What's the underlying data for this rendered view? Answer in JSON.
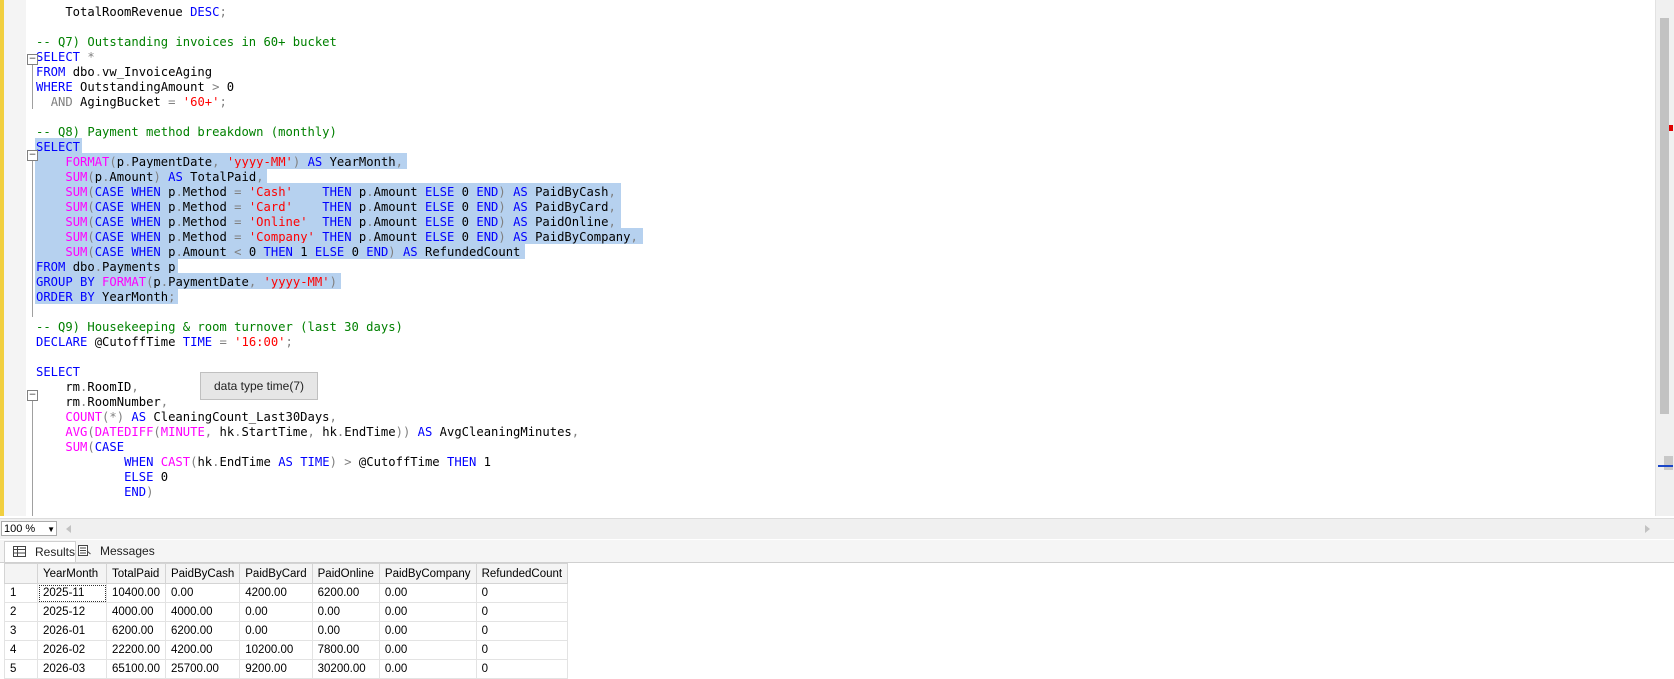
{
  "editor": {
    "lines": [
      {
        "segs": [
          [
            "",
            "    TotalRoomRevenue "
          ],
          [
            "kw",
            "DESC"
          ],
          [
            "op",
            ";"
          ]
        ]
      },
      {
        "segs": []
      },
      {
        "segs": [
          [
            "cm",
            "-- Q7) Outstanding invoices in 60+ bucket"
          ]
        ]
      },
      {
        "segs": [
          [
            "kw",
            "SELECT "
          ],
          [
            "op",
            "*"
          ]
        ]
      },
      {
        "segs": [
          [
            "kw",
            "FROM "
          ],
          [
            "",
            "dbo"
          ],
          [
            "op",
            "."
          ],
          [
            "",
            "vw_InvoiceAging"
          ]
        ]
      },
      {
        "segs": [
          [
            "kw",
            "WHERE "
          ],
          [
            "",
            "OutstandingAmount "
          ],
          [
            "op",
            ">"
          ],
          [
            "",
            " 0"
          ]
        ]
      },
      {
        "segs": [
          [
            "",
            "  "
          ],
          [
            "op",
            "AND "
          ],
          [
            "",
            "AgingBucket "
          ],
          [
            "op",
            "="
          ],
          [
            "",
            " "
          ],
          [
            "str",
            "'60+'"
          ],
          [
            "op",
            ";"
          ]
        ]
      },
      {
        "segs": []
      },
      {
        "segs": [
          [
            "cm",
            "-- Q8) Payment method breakdown (monthly)"
          ]
        ]
      },
      {
        "segs": [
          [
            "kw",
            "SELECT"
          ]
        ]
      },
      {
        "segs": [
          [
            "",
            "    "
          ],
          [
            "fn",
            "FORMAT"
          ],
          [
            "op",
            "("
          ],
          [
            "",
            "p"
          ],
          [
            "op",
            "."
          ],
          [
            "",
            "PaymentDate"
          ],
          [
            "op",
            ","
          ],
          [
            "",
            " "
          ],
          [
            "str",
            "'yyyy-MM'"
          ],
          [
            "op",
            ")"
          ],
          [
            "",
            " "
          ],
          [
            "kw",
            "AS "
          ],
          [
            "",
            "YearMonth"
          ],
          [
            "op",
            ","
          ]
        ]
      },
      {
        "segs": [
          [
            "",
            "    "
          ],
          [
            "fn",
            "SUM"
          ],
          [
            "op",
            "("
          ],
          [
            "",
            "p"
          ],
          [
            "op",
            "."
          ],
          [
            "",
            "Amount"
          ],
          [
            "op",
            ")"
          ],
          [
            "",
            " "
          ],
          [
            "kw",
            "AS "
          ],
          [
            "",
            "TotalPaid"
          ],
          [
            "op",
            ","
          ]
        ]
      },
      {
        "segs": [
          [
            "",
            "    "
          ],
          [
            "fn",
            "SUM"
          ],
          [
            "op",
            "("
          ],
          [
            "kw",
            "CASE WHEN "
          ],
          [
            "",
            "p"
          ],
          [
            "op",
            "."
          ],
          [
            "",
            "Method "
          ],
          [
            "op",
            "="
          ],
          [
            "",
            " "
          ],
          [
            "str",
            "'Cash'"
          ],
          [
            "",
            "    "
          ],
          [
            "kw",
            "THEN "
          ],
          [
            "",
            "p"
          ],
          [
            "op",
            "."
          ],
          [
            "",
            "Amount "
          ],
          [
            "kw",
            "ELSE "
          ],
          [
            "",
            "0 "
          ],
          [
            "kw",
            "END"
          ],
          [
            "op",
            ")"
          ],
          [
            "",
            " "
          ],
          [
            "kw",
            "AS "
          ],
          [
            "",
            "PaidByCash"
          ],
          [
            "op",
            ","
          ]
        ]
      },
      {
        "segs": [
          [
            "",
            "    "
          ],
          [
            "fn",
            "SUM"
          ],
          [
            "op",
            "("
          ],
          [
            "kw",
            "CASE WHEN "
          ],
          [
            "",
            "p"
          ],
          [
            "op",
            "."
          ],
          [
            "",
            "Method "
          ],
          [
            "op",
            "="
          ],
          [
            "",
            " "
          ],
          [
            "str",
            "'Card'"
          ],
          [
            "",
            "    "
          ],
          [
            "kw",
            "THEN "
          ],
          [
            "",
            "p"
          ],
          [
            "op",
            "."
          ],
          [
            "",
            "Amount "
          ],
          [
            "kw",
            "ELSE "
          ],
          [
            "",
            "0 "
          ],
          [
            "kw",
            "END"
          ],
          [
            "op",
            ")"
          ],
          [
            "",
            " "
          ],
          [
            "kw",
            "AS "
          ],
          [
            "",
            "PaidByCard"
          ],
          [
            "op",
            ","
          ]
        ]
      },
      {
        "segs": [
          [
            "",
            "    "
          ],
          [
            "fn",
            "SUM"
          ],
          [
            "op",
            "("
          ],
          [
            "kw",
            "CASE WHEN "
          ],
          [
            "",
            "p"
          ],
          [
            "op",
            "."
          ],
          [
            "",
            "Method "
          ],
          [
            "op",
            "="
          ],
          [
            "",
            " "
          ],
          [
            "str",
            "'Online'"
          ],
          [
            "",
            "  "
          ],
          [
            "kw",
            "THEN "
          ],
          [
            "",
            "p"
          ],
          [
            "op",
            "."
          ],
          [
            "",
            "Amount "
          ],
          [
            "kw",
            "ELSE "
          ],
          [
            "",
            "0 "
          ],
          [
            "kw",
            "END"
          ],
          [
            "op",
            ")"
          ],
          [
            "",
            " "
          ],
          [
            "kw",
            "AS "
          ],
          [
            "",
            "PaidOnline"
          ],
          [
            "op",
            ","
          ]
        ]
      },
      {
        "segs": [
          [
            "",
            "    "
          ],
          [
            "fn",
            "SUM"
          ],
          [
            "op",
            "("
          ],
          [
            "kw",
            "CASE WHEN "
          ],
          [
            "",
            "p"
          ],
          [
            "op",
            "."
          ],
          [
            "",
            "Method "
          ],
          [
            "op",
            "="
          ],
          [
            "",
            " "
          ],
          [
            "str",
            "'Company'"
          ],
          [
            "",
            " "
          ],
          [
            "kw",
            "THEN "
          ],
          [
            "",
            "p"
          ],
          [
            "op",
            "."
          ],
          [
            "",
            "Amount "
          ],
          [
            "kw",
            "ELSE "
          ],
          [
            "",
            "0 "
          ],
          [
            "kw",
            "END"
          ],
          [
            "op",
            ")"
          ],
          [
            "",
            " "
          ],
          [
            "kw",
            "AS "
          ],
          [
            "",
            "PaidByCompany"
          ],
          [
            "op",
            ","
          ]
        ]
      },
      {
        "segs": [
          [
            "",
            "    "
          ],
          [
            "fn",
            "SUM"
          ],
          [
            "op",
            "("
          ],
          [
            "kw",
            "CASE WHEN "
          ],
          [
            "",
            "p"
          ],
          [
            "op",
            "."
          ],
          [
            "",
            "Amount "
          ],
          [
            "op",
            "<"
          ],
          [
            "",
            " 0 "
          ],
          [
            "kw",
            "THEN "
          ],
          [
            "",
            "1 "
          ],
          [
            "kw",
            "ELSE "
          ],
          [
            "",
            "0 "
          ],
          [
            "kw",
            "END"
          ],
          [
            "op",
            ")"
          ],
          [
            "",
            " "
          ],
          [
            "kw",
            "AS "
          ],
          [
            "",
            "RefundedCount"
          ]
        ]
      },
      {
        "segs": [
          [
            "kw",
            "FROM "
          ],
          [
            "",
            "dbo"
          ],
          [
            "op",
            "."
          ],
          [
            "",
            "Payments p"
          ]
        ]
      },
      {
        "segs": [
          [
            "kw",
            "GROUP BY "
          ],
          [
            "fn",
            "FORMAT"
          ],
          [
            "op",
            "("
          ],
          [
            "",
            "p"
          ],
          [
            "op",
            "."
          ],
          [
            "",
            "PaymentDate"
          ],
          [
            "op",
            ","
          ],
          [
            "",
            " "
          ],
          [
            "str",
            "'yyyy-MM'"
          ],
          [
            "op",
            ")"
          ]
        ]
      },
      {
        "segs": [
          [
            "kw",
            "ORDER BY "
          ],
          [
            "",
            "YearMonth"
          ],
          [
            "op",
            ";"
          ]
        ]
      },
      {
        "segs": []
      },
      {
        "segs": [
          [
            "cm",
            "-- Q9) Housekeeping & room turnover (last 30 days)"
          ]
        ]
      },
      {
        "segs": [
          [
            "kw",
            "DECLARE "
          ],
          [
            "",
            "@CutoffTime "
          ],
          [
            "kw",
            "TIME "
          ],
          [
            "op",
            "="
          ],
          [
            "",
            " "
          ],
          [
            "str",
            "'16:00'"
          ],
          [
            "op",
            ";"
          ]
        ]
      },
      {
        "segs": []
      },
      {
        "segs": [
          [
            "kw",
            "SELECT"
          ]
        ]
      },
      {
        "segs": [
          [
            "",
            "    rm"
          ],
          [
            "op",
            "."
          ],
          [
            "",
            "RoomID"
          ],
          [
            "op",
            ","
          ]
        ]
      },
      {
        "segs": [
          [
            "",
            "    rm"
          ],
          [
            "op",
            "."
          ],
          [
            "",
            "RoomNumber"
          ],
          [
            "op",
            ","
          ]
        ]
      },
      {
        "segs": [
          [
            "",
            "    "
          ],
          [
            "fn",
            "COUNT"
          ],
          [
            "op",
            "(*)"
          ],
          [
            "",
            " "
          ],
          [
            "kw",
            "AS "
          ],
          [
            "",
            "CleaningCount_Last30Days"
          ],
          [
            "op",
            ","
          ]
        ]
      },
      {
        "segs": [
          [
            "",
            "    "
          ],
          [
            "fn",
            "AVG"
          ],
          [
            "op",
            "("
          ],
          [
            "fn",
            "DATEDIFF"
          ],
          [
            "op",
            "("
          ],
          [
            "fn",
            "MINUTE"
          ],
          [
            "op",
            ","
          ],
          [
            "",
            " hk"
          ],
          [
            "op",
            "."
          ],
          [
            "",
            "StartTime"
          ],
          [
            "op",
            ","
          ],
          [
            "",
            " hk"
          ],
          [
            "op",
            "."
          ],
          [
            "",
            "EndTime"
          ],
          [
            "op",
            "))"
          ],
          [
            "",
            " "
          ],
          [
            "kw",
            "AS "
          ],
          [
            "",
            "AvgCleaningMinutes"
          ],
          [
            "op",
            ","
          ]
        ]
      },
      {
        "segs": [
          [
            "",
            "    "
          ],
          [
            "fn",
            "SUM"
          ],
          [
            "op",
            "("
          ],
          [
            "kw",
            "CASE"
          ]
        ]
      },
      {
        "segs": [
          [
            "",
            "            "
          ],
          [
            "kw",
            "WHEN "
          ],
          [
            "fn",
            "CAST"
          ],
          [
            "op",
            "("
          ],
          [
            "",
            "hk"
          ],
          [
            "op",
            "."
          ],
          [
            "",
            "EndTime "
          ],
          [
            "kw",
            "AS TIME"
          ],
          [
            "op",
            ")"
          ],
          [
            "",
            " "
          ],
          [
            "op",
            ">"
          ],
          [
            "",
            " @CutoffTime "
          ],
          [
            "kw",
            "THEN "
          ],
          [
            "",
            "1"
          ]
        ]
      },
      {
        "segs": [
          [
            "",
            "            "
          ],
          [
            "kw",
            "ELSE "
          ],
          [
            "",
            "0"
          ]
        ]
      },
      {
        "segs": [
          [
            "",
            "            "
          ],
          [
            "kw",
            "END"
          ],
          [
            "op",
            ")"
          ]
        ]
      }
    ],
    "tooltip": "data type time(7)",
    "zoom": "100 %"
  },
  "tabs": [
    {
      "label": "Results",
      "icon": "grid-icon"
    },
    {
      "label": "Messages",
      "icon": "messages-icon"
    }
  ],
  "results": {
    "columns": [
      "YearMonth",
      "TotalPaid",
      "PaidByCash",
      "PaidByCard",
      "PaidOnline",
      "PaidByCompany",
      "RefundedCount"
    ],
    "rows": [
      [
        "1",
        "2025-11",
        "10400.00",
        "0.00",
        "4200.00",
        "6200.00",
        "0.00",
        "0"
      ],
      [
        "2",
        "2025-12",
        "4000.00",
        "4000.00",
        "0.00",
        "0.00",
        "0.00",
        "0"
      ],
      [
        "3",
        "2026-01",
        "6200.00",
        "6200.00",
        "0.00",
        "0.00",
        "0.00",
        "0"
      ],
      [
        "4",
        "2026-02",
        "22200.00",
        "4200.00",
        "10200.00",
        "7800.00",
        "0.00",
        "0"
      ],
      [
        "5",
        "2026-03",
        "65100.00",
        "25700.00",
        "9200.00",
        "30200.00",
        "0.00",
        "0"
      ]
    ]
  }
}
